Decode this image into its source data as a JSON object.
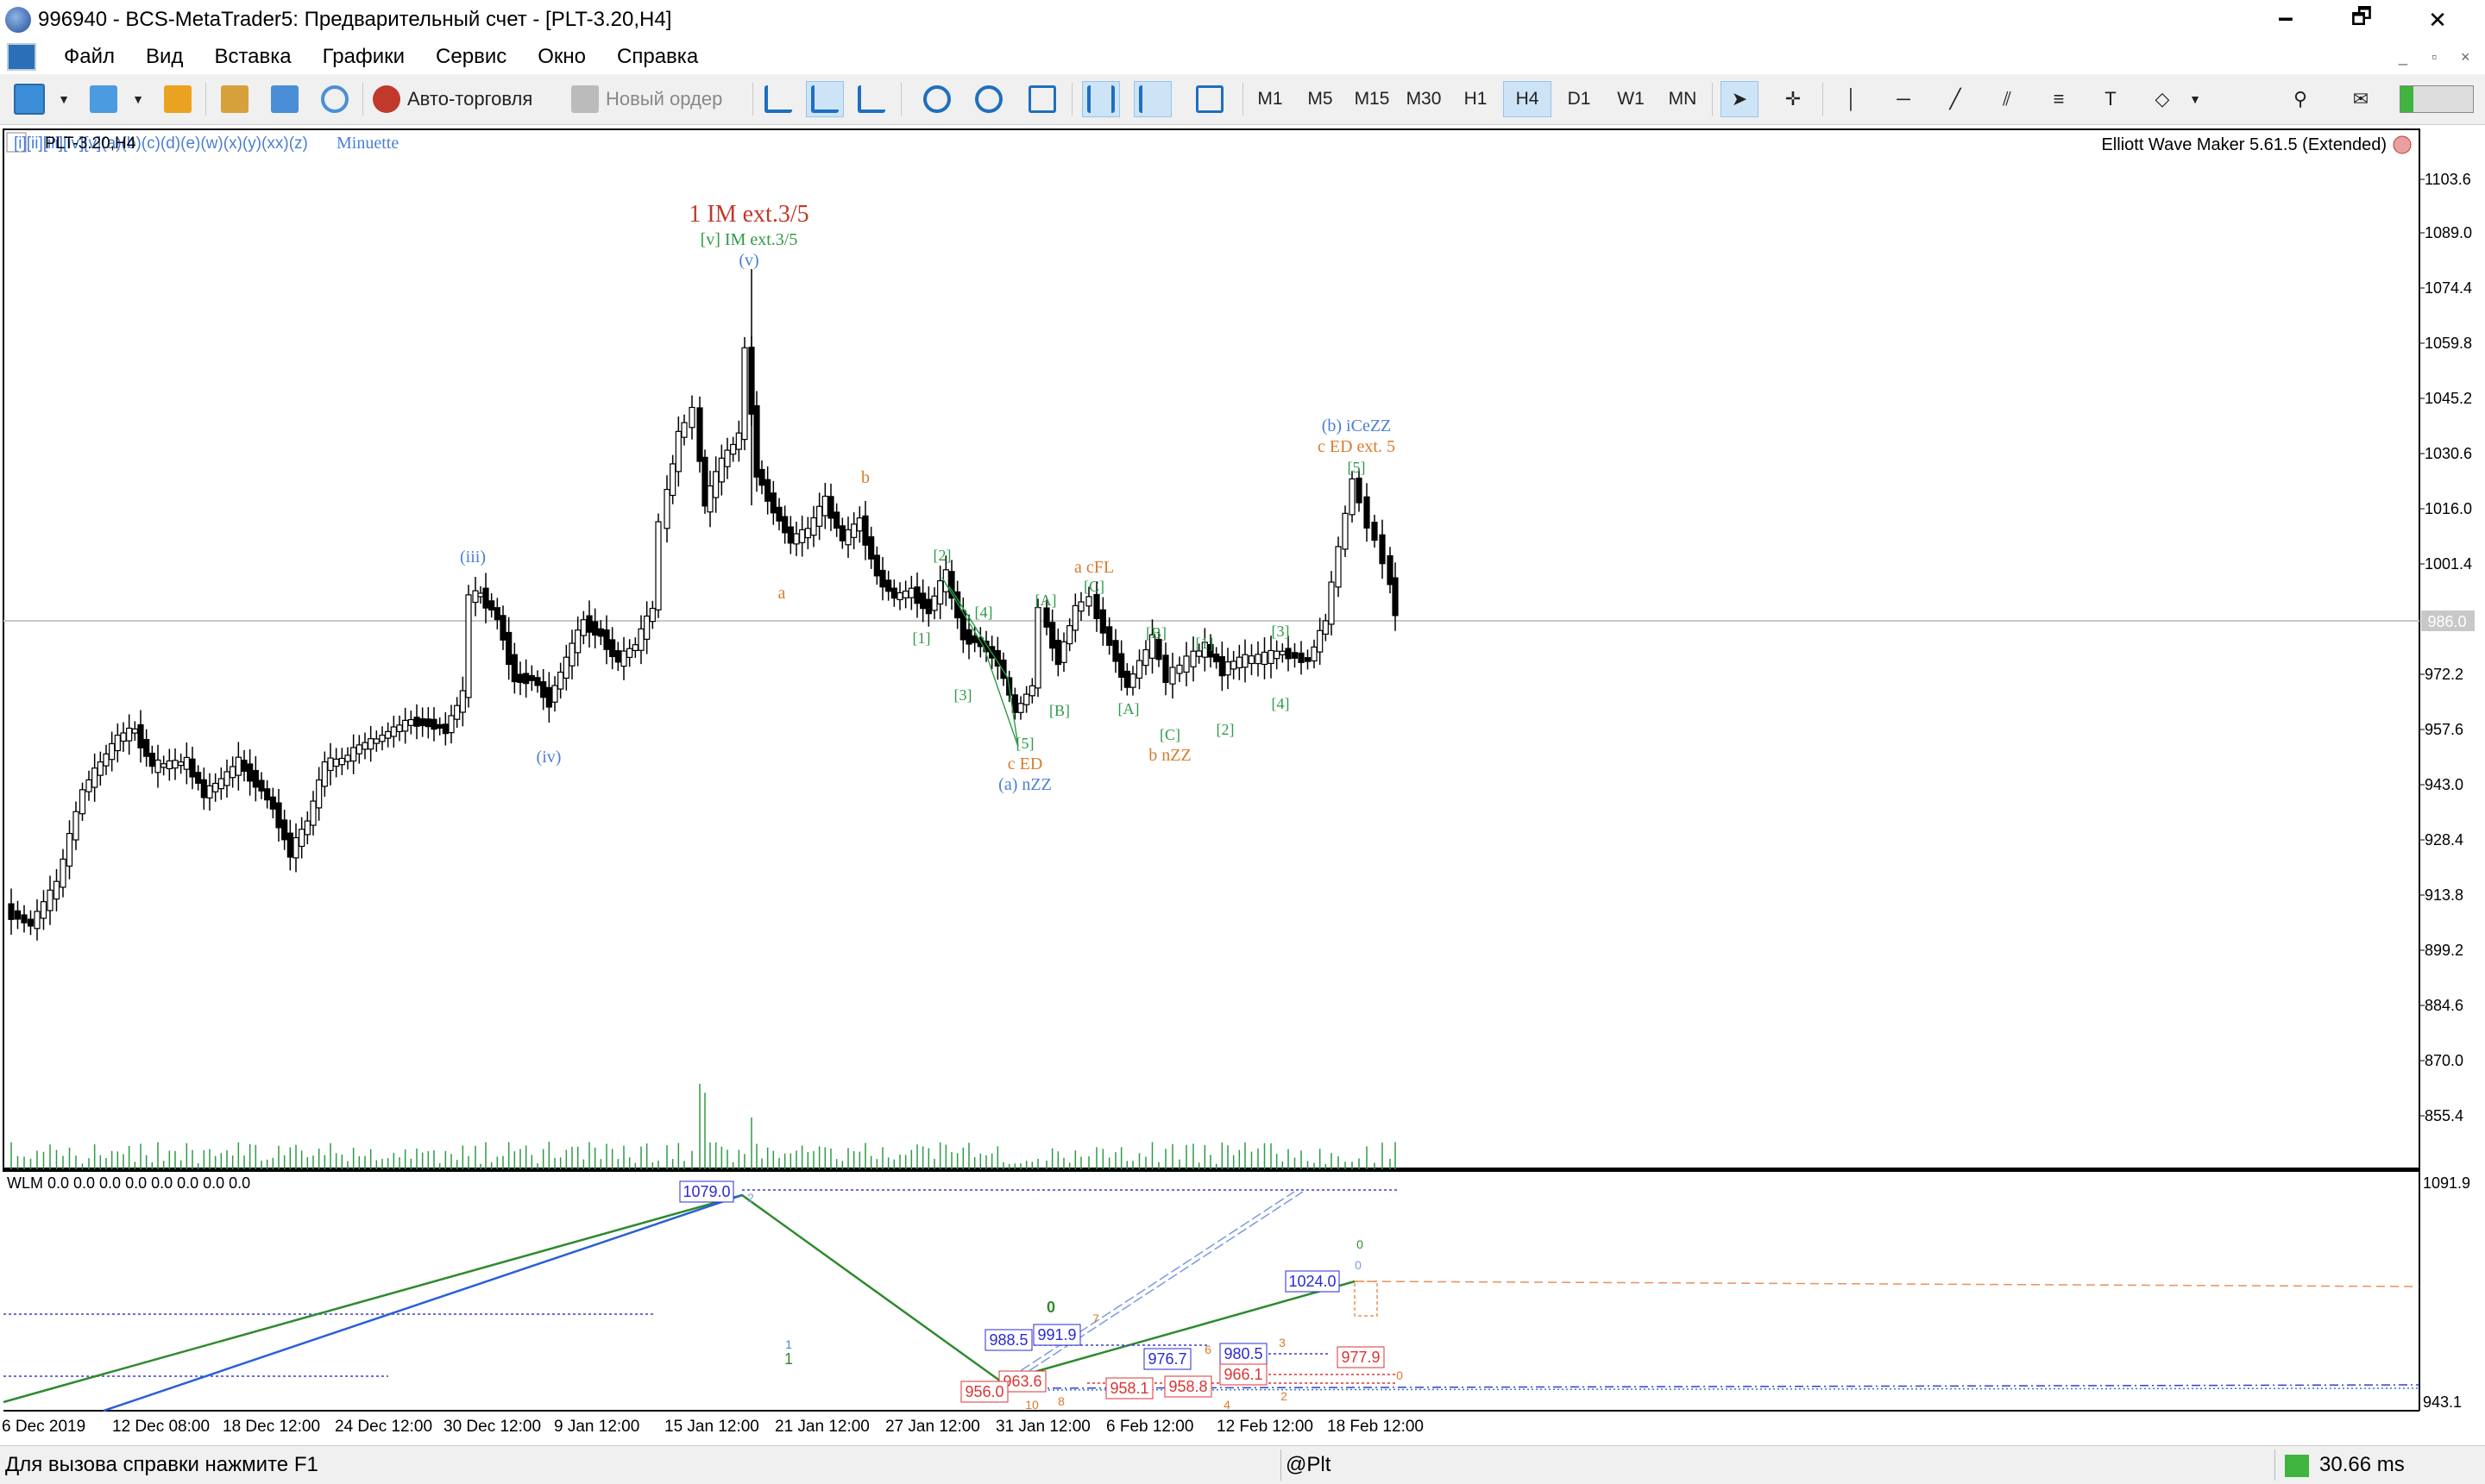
{
  "window": {
    "title": "996940 - BCS-MetaTrader5: Предварительный счет - [PLT-3.20,H4]",
    "minimize_glyph": "🗕",
    "restore_glyph": "🗗",
    "close_glyph": "✕"
  },
  "menu": {
    "items": [
      "Файл",
      "Вид",
      "Вставка",
      "Графики",
      "Сервис",
      "Окно",
      "Справка"
    ],
    "mdi_controls": [
      "_",
      "▫",
      "×"
    ]
  },
  "toolbar": {
    "autotrading_label": "Авто-торговля",
    "new_order_label": "Новый ордер",
    "timeframes": [
      "M1",
      "M5",
      "M15",
      "M30",
      "H1",
      "H4",
      "D1",
      "W1",
      "MN"
    ],
    "selected_timeframe": "H4",
    "icons": [
      "new-chart-icon",
      "dropdown-icon",
      "profiles-icon",
      "dropdown-icon",
      "market-watch-icon",
      "navigator-icon",
      "strategy-tester-icon",
      "signals-icon",
      "autotrading-icon",
      "new-order-icon",
      "bar-chart-icon",
      "candlestick-chart-icon",
      "line-chart-icon",
      "zoom-in-icon",
      "zoom-out-icon",
      "tile-windows-icon",
      "chart-shift-icon",
      "autoscroll-icon",
      "templates-icon",
      "cursor-icon",
      "crosshair-icon",
      "vertical-line-icon",
      "horizontal-line-icon",
      "trendline-icon",
      "equidistant-channel-icon",
      "fibonacci-icon",
      "text-icon",
      "shapes-icon",
      "search-icon",
      "chat-icon"
    ]
  },
  "chart": {
    "symbol_label": "PLT-3.20,H4",
    "wave_degrees_text": "[i][ii][iii][iv][v](a)(b)(c)(d)(e)(w)(x)(y)(xx)(z)",
    "degree_label": "Minuette",
    "ea_label": "Elliott Wave Maker 5.61.5 (Extended)",
    "current_price": "986.0",
    "price_axis": [
      "1103.6",
      "1089.0",
      "1074.4",
      "1059.8",
      "1045.2",
      "1030.6",
      "1016.0",
      "1001.4",
      "986.0",
      "972.2",
      "957.6",
      "943.0",
      "928.4",
      "913.8",
      "899.2",
      "884.6",
      "870.0",
      "855.4"
    ],
    "date_axis": [
      "6 Dec 2019",
      "12 Dec 08:00",
      "18 Dec 12:00",
      "24 Dec 12:00",
      "30 Dec 12:00",
      "9 Jan 12:00",
      "15 Jan 12:00",
      "21 Jan 12:00",
      "27 Jan 12:00",
      "31 Jan 12:00",
      "6 Feb 12:00",
      "12 Feb 12:00",
      "18 Feb 12:00"
    ],
    "wave_labels": {
      "top_red": "1 IM ext.3/5",
      "top_green": "[v] IM ext.3/5",
      "v": "(v)",
      "iii": "(iii)",
      "iv": "(iv)",
      "a_orange": "a",
      "b_orange": "b",
      "bracket1": "[1]",
      "bracket2": "[2]",
      "bracket3": "[3]",
      "bracket4": "[4]",
      "bracket5": "[5]",
      "c_ed": "c ED",
      "a_nzz": "(a) nZZ",
      "bracketA": "[A]",
      "bracketB": "[B]",
      "bracketC": "[C]",
      "a_cfl": "a cFL",
      "b_nzz": "b nZZ",
      "b_icezz": "(b) iCeZZ",
      "c_ed_ext5": "c ED ext. 5"
    },
    "colors": {
      "wave_blue": "#4a7fd4",
      "wave_green": "#2e9a47",
      "wave_orange": "#d97b2b",
      "wave_red": "#c0392b"
    }
  },
  "subwindow": {
    "indicator_label": "WLM 0.0 0.0 0.0 0.0 0.0 0.0 0.0 0.0",
    "price_axis": [
      "1091.9",
      "943.1"
    ],
    "boxes": {
      "b1079": "1079.0",
      "b1024": "1024.0",
      "b988": "988.5",
      "b991": "991.9",
      "b976": "976.7",
      "b980": "980.5",
      "b977": "977.9",
      "b966": "966.1",
      "b963": "963.6",
      "b956": "956.0",
      "b958a": "958.1",
      "b958b": "958.8"
    },
    "small_labels": {
      "zero_green": "0",
      "one_green": "1",
      "one_blue": "1",
      "zero_top": "0",
      "two_top": "2",
      "zero_right": "0",
      "seven": "7",
      "six": "6",
      "three": "3",
      "eight": "8",
      "ten": "10",
      "four": "4",
      "two": "2",
      "zero_end": "0"
    }
  },
  "status": {
    "help_text": "Для вызова справки нажмите F1",
    "profile": "@Plt",
    "ping": "30.66 ms"
  }
}
